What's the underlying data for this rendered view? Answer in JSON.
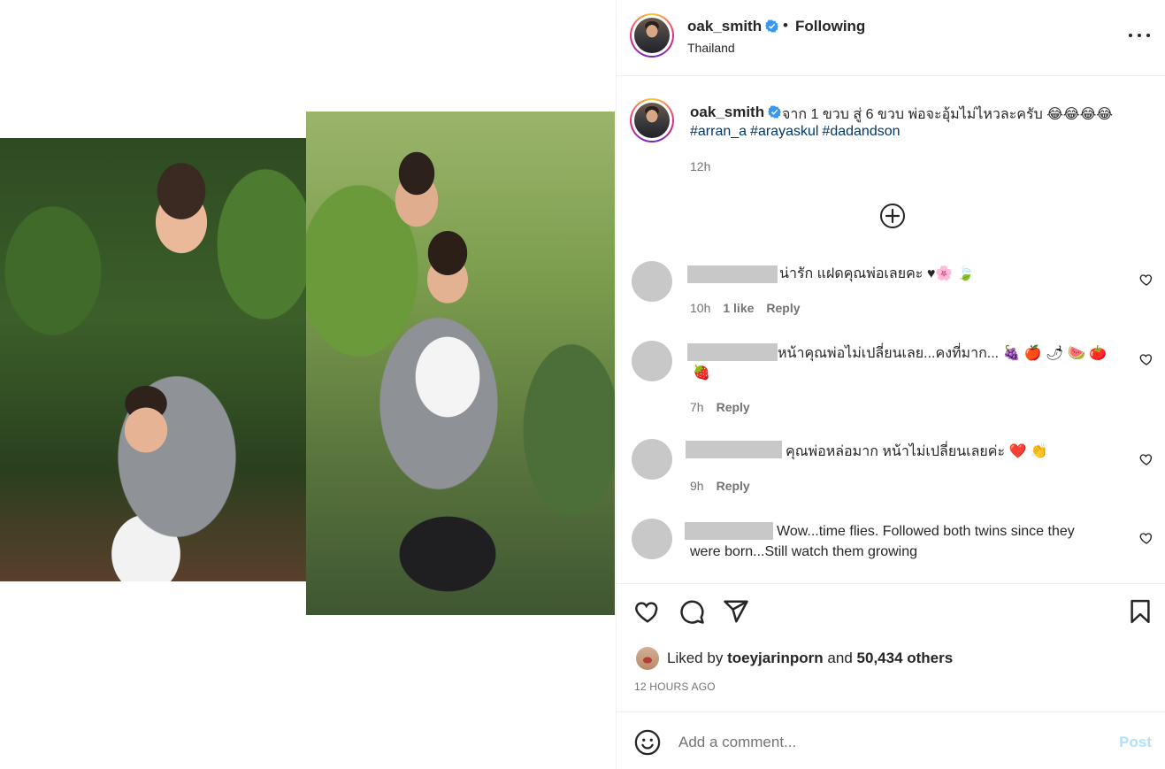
{
  "header": {
    "username": "oak_smith",
    "follow_status": "Following",
    "separator": "•",
    "location": "Thailand"
  },
  "caption": {
    "username": "oak_smith",
    "text": "จาก 1 ขวบ สู่ 6 ขวบ พ่อจะอุ้มไม่ไหวละครับ 😂😂😂😂",
    "hashtags": [
      "#arran_a",
      "#arayaskul",
      "#dadandson"
    ],
    "time": "12h"
  },
  "comments": [
    {
      "text": "น่ารัก แฝดคุณพ่อเลยคะ ♥🌸 🍃",
      "time": "10h",
      "likes": "1 like",
      "reply": "Reply"
    },
    {
      "text": "หน้าคุณพ่อไม่เปลี่ยนเลย...คงที่มาก... 🍇 🍎 🌶 🍉 🍅",
      "text2": "🍓",
      "time": "7h",
      "reply": "Reply"
    },
    {
      "text": "คุณพ่อหล่อมาก หน้าไม่เปลี่ยนเลยค่ะ ❤️ 👏",
      "time": "9h",
      "reply": "Reply"
    },
    {
      "text": "Wow...time flies. Followed both twins since they",
      "text2": "were born...Still watch them growing"
    }
  ],
  "likes": {
    "prefix": "Liked by",
    "user": "toeyjarinporn",
    "joiner": "and",
    "others": "50,434 others"
  },
  "post_date": "12 HOURS AGO",
  "add_comment": {
    "placeholder": "Add a comment...",
    "post_label": "Post"
  },
  "icons": {
    "verified": "verified-badge-icon",
    "more": "more-options-icon",
    "load_more": "plus-circle-icon",
    "like": "heart-icon",
    "comment": "comment-bubble-icon",
    "share": "paper-plane-icon",
    "save": "bookmark-icon",
    "emoji": "smiley-icon"
  },
  "colors": {
    "verified_blue": "#3897f0",
    "link_blue": "#00376b",
    "post_disabled": "#b2dffc",
    "muted_text": "#737373"
  }
}
